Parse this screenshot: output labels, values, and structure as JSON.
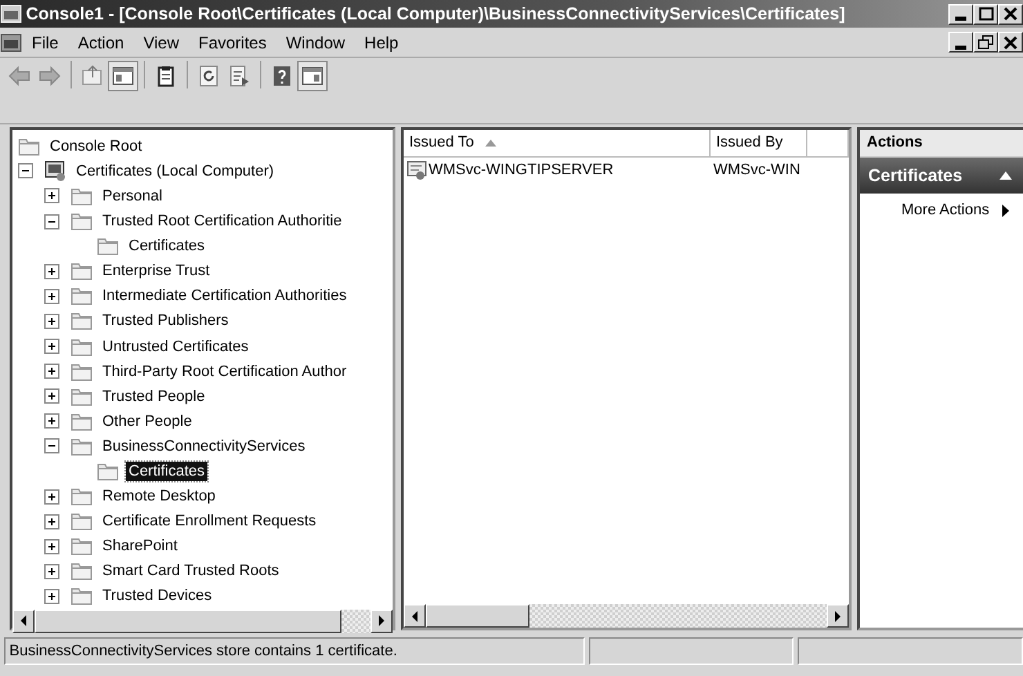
{
  "window": {
    "title": "Console1 - [Console Root\\Certificates (Local Computer)\\BusinessConnectivityServices\\Certificates]"
  },
  "menu": [
    "File",
    "Action",
    "View",
    "Favorites",
    "Window",
    "Help"
  ],
  "toolbar": [
    {
      "kind": "back",
      "pressed": false
    },
    {
      "kind": "forward",
      "pressed": false
    },
    {
      "kind": "sep"
    },
    {
      "kind": "up",
      "pressed": false
    },
    {
      "kind": "tree-pane",
      "pressed": true
    },
    {
      "kind": "sep"
    },
    {
      "kind": "clipboard",
      "pressed": false
    },
    {
      "kind": "sep"
    },
    {
      "kind": "refresh",
      "pressed": false
    },
    {
      "kind": "export",
      "pressed": false
    },
    {
      "kind": "sep"
    },
    {
      "kind": "help",
      "pressed": false
    },
    {
      "kind": "action-pane",
      "pressed": true
    }
  ],
  "tree": [
    {
      "label": "Console Root",
      "kind": "folder",
      "selected": false,
      "children": [
        {
          "label": "Certificates (Local Computer)",
          "kind": "store-root",
          "expanded": true,
          "selected": false,
          "children": [
            {
              "label": "Personal",
              "kind": "folder",
              "expanded": false,
              "selected": false
            },
            {
              "label": "Trusted Root Certification Authoritie",
              "kind": "folder",
              "expanded": true,
              "selected": false,
              "children": [
                {
                  "label": "Certificates",
                  "kind": "folder",
                  "selected": false
                }
              ]
            },
            {
              "label": "Enterprise Trust",
              "kind": "folder",
              "expanded": false,
              "selected": false
            },
            {
              "label": "Intermediate Certification Authorities",
              "kind": "folder",
              "expanded": false,
              "selected": false
            },
            {
              "label": "Trusted Publishers",
              "kind": "folder",
              "expanded": false,
              "selected": false
            },
            {
              "label": "Untrusted Certificates",
              "kind": "folder",
              "expanded": false,
              "selected": false
            },
            {
              "label": "Third-Party Root Certification Author",
              "kind": "folder",
              "expanded": false,
              "selected": false
            },
            {
              "label": "Trusted People",
              "kind": "folder",
              "expanded": false,
              "selected": false
            },
            {
              "label": "Other People",
              "kind": "folder",
              "expanded": false,
              "selected": false
            },
            {
              "label": "BusinessConnectivityServices",
              "kind": "folder",
              "expanded": true,
              "selected": false,
              "children": [
                {
                  "label": "Certificates",
                  "kind": "folder",
                  "selected": true
                }
              ]
            },
            {
              "label": "Remote Desktop",
              "kind": "folder",
              "expanded": false,
              "selected": false
            },
            {
              "label": "Certificate Enrollment Requests",
              "kind": "folder",
              "expanded": false,
              "selected": false
            },
            {
              "label": "SharePoint",
              "kind": "folder",
              "expanded": false,
              "selected": false
            },
            {
              "label": "Smart Card Trusted Roots",
              "kind": "folder",
              "expanded": false,
              "selected": false
            },
            {
              "label": "Trusted Devices",
              "kind": "folder",
              "expanded": false,
              "selected": false
            }
          ]
        }
      ]
    }
  ],
  "table": {
    "columns": [
      {
        "label": "Issued To",
        "sorted": true
      },
      {
        "label": "Issued By",
        "sorted": false
      }
    ],
    "rows": [
      [
        "WMSvc-WINGTIPSERVER",
        "WMSvc-WIN"
      ]
    ]
  },
  "actions": {
    "title": "Actions",
    "section": "Certificates",
    "items": [
      "More Actions"
    ]
  },
  "status_bar": "BusinessConnectivityServices store contains 1 certificate."
}
